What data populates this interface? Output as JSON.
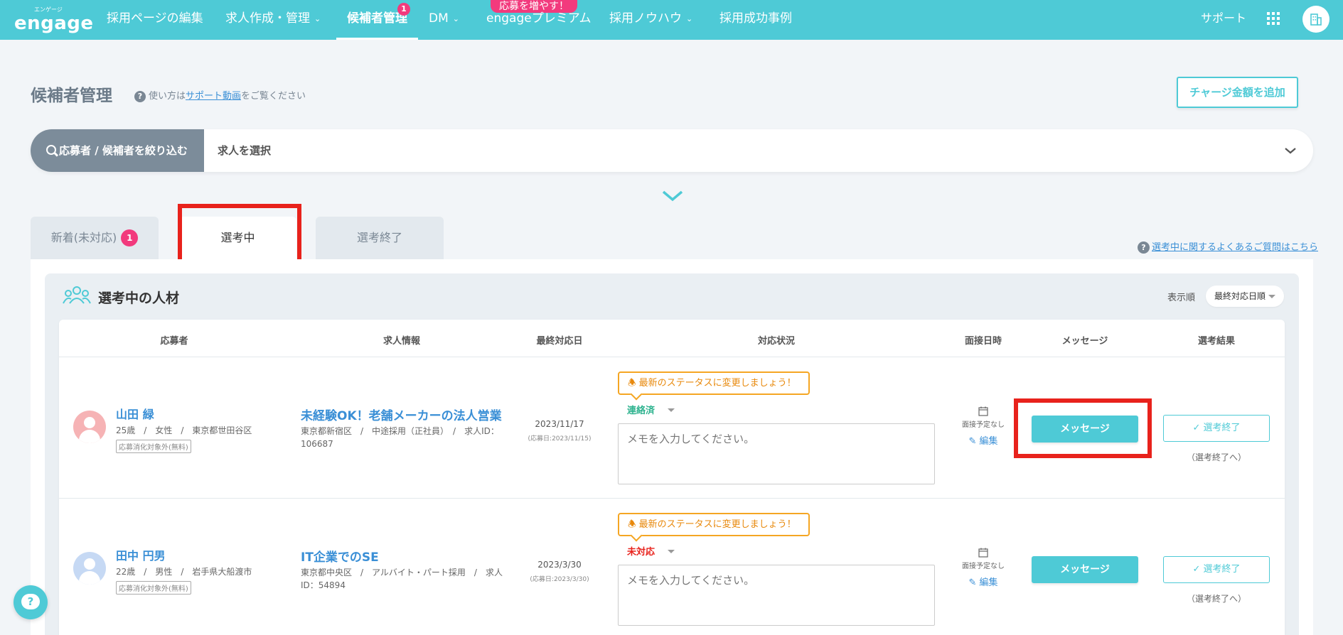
{
  "nav": {
    "logo_kana": "エンゲージ",
    "logo": "engage",
    "items": [
      {
        "label": "採用ページの編集"
      },
      {
        "label": "求人作成・管理"
      },
      {
        "label": "候補者管理",
        "badge": "1"
      },
      {
        "label": "DM"
      },
      {
        "label": "engageプレミアム"
      },
      {
        "label": "採用ノウハウ"
      },
      {
        "label": "採用成功事例"
      }
    ],
    "promo": "応募を増やす！",
    "support": "サポート",
    "colors": {
      "primary": "#4ecad6",
      "badge": "#f23a7d",
      "highlight": "#e8221c"
    }
  },
  "header": {
    "title": "候補者管理",
    "help_prefix": "使い方は",
    "help_link": "サポート動画",
    "help_suffix": "をご覧ください",
    "charge_button": "チャージ金額を追加"
  },
  "filter": {
    "button": "応募者 / 候補者を絞り込む",
    "job_placeholder": "求人を選択"
  },
  "tabs": [
    {
      "label": "新着(未対応)",
      "count": "1"
    },
    {
      "label": "選考中"
    },
    {
      "label": "選考終了"
    }
  ],
  "faq_link": "選考中に関するよくあるご質問はこちら",
  "panel": {
    "title": "選考中の人材",
    "sort_label": "表示順",
    "sort_value": "最終対応日順"
  },
  "table": {
    "headers": [
      "応募者",
      "求人情報",
      "最終対応日",
      "対応状況",
      "面接日時",
      "メッセージ",
      "選考結果"
    ],
    "rows": [
      {
        "name": "山田 緑",
        "meta": "25歳　/　女性　/　東京都世田谷区",
        "tag": "応募消化対象外(無料)",
        "job_title": "未経験OK！老舗メーカーの法人営業",
        "job_meta": "東京都新宿区　/　中途採用（正社員）　/　求人ID：106687",
        "last_date": "2023/11/17",
        "applied": "(応募日:2023/11/15)",
        "notice": "最新のステータスに変更しましょう！",
        "status": "連絡済",
        "status_color": "#2fb38f",
        "memo_placeholder": "メモを入力してください。",
        "interview": "面接予定なし",
        "edit": "編集",
        "message_button": "メッセージ",
        "end_button": "選考終了",
        "end_sub": "（選考終了へ）",
        "avatar_color": "#f6b3b5"
      },
      {
        "name": "田中 円男",
        "meta": "22歳　/　男性　/　岩手県大船渡市",
        "tag": "応募消化対象外(無料)",
        "job_title": "IT企業でのSE",
        "job_meta": "東京都中央区　/　アルバイト・パート採用　/　求人ID：54894",
        "last_date": "2023/3/30",
        "applied": "(応募日:2023/3/30)",
        "notice": "最新のステータスに変更しましょう！",
        "status": "未対応",
        "status_color": "#e8221c",
        "memo_placeholder": "メモを入力してください。",
        "interview": "面接予定なし",
        "edit": "編集",
        "message_button": "メッセージ",
        "end_button": "選考終了",
        "end_sub": "（選考終了へ）",
        "avatar_color": "#c6d9f4"
      }
    ]
  }
}
